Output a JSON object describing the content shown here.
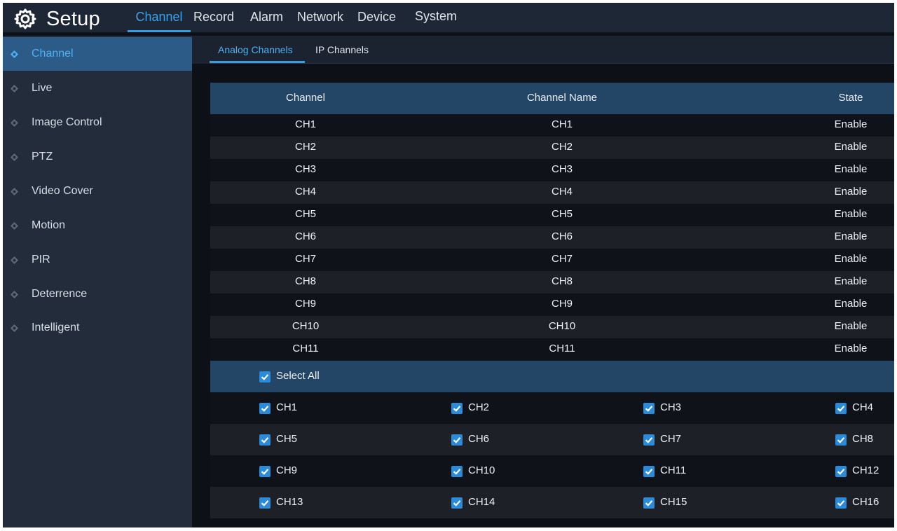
{
  "app": {
    "title": "Setup",
    "icon": "gear-icon"
  },
  "top_tabs": [
    "Channel",
    "Record",
    "Alarm",
    "Network",
    "Device",
    "System"
  ],
  "active_top_tab": "Channel",
  "sidebar": {
    "items": [
      {
        "label": "Channel",
        "active": true
      },
      {
        "label": "Live"
      },
      {
        "label": "Image Control"
      },
      {
        "label": "PTZ"
      },
      {
        "label": "Video Cover"
      },
      {
        "label": "Motion"
      },
      {
        "label": "PIR"
      },
      {
        "label": "Deterrence"
      },
      {
        "label": "Intelligent"
      }
    ]
  },
  "sub_tabs": [
    {
      "label": "Analog Channels",
      "active": true
    },
    {
      "label": "IP Channels"
    }
  ],
  "table": {
    "headers": [
      "Channel",
      "Channel Name",
      "State"
    ],
    "rows": [
      [
        "CH1",
        "CH1",
        "Enable"
      ],
      [
        "CH2",
        "CH2",
        "Enable"
      ],
      [
        "CH3",
        "CH3",
        "Enable"
      ],
      [
        "CH4",
        "CH4",
        "Enable"
      ],
      [
        "CH5",
        "CH5",
        "Enable"
      ],
      [
        "CH6",
        "CH6",
        "Enable"
      ],
      [
        "CH7",
        "CH7",
        "Enable"
      ],
      [
        "CH8",
        "CH8",
        "Enable"
      ],
      [
        "CH9",
        "CH9",
        "Enable"
      ],
      [
        "CH10",
        "CH10",
        "Enable"
      ],
      [
        "CH11",
        "CH11",
        "Enable"
      ]
    ]
  },
  "select_all": {
    "label": "Select All",
    "checked": true
  },
  "channel_checkboxes": [
    {
      "label": "CH1",
      "checked": true
    },
    {
      "label": "CH2",
      "checked": true
    },
    {
      "label": "CH3",
      "checked": true
    },
    {
      "label": "CH4",
      "checked": true
    },
    {
      "label": "CH5",
      "checked": true
    },
    {
      "label": "CH6",
      "checked": true
    },
    {
      "label": "CH7",
      "checked": true
    },
    {
      "label": "CH8",
      "checked": true
    },
    {
      "label": "CH9",
      "checked": true
    },
    {
      "label": "CH10",
      "checked": true
    },
    {
      "label": "CH11",
      "checked": true
    },
    {
      "label": "CH12",
      "checked": true
    },
    {
      "label": "CH13",
      "checked": true
    },
    {
      "label": "CH14",
      "checked": true
    },
    {
      "label": "CH15",
      "checked": true
    },
    {
      "label": "CH16",
      "checked": true
    }
  ],
  "colors": {
    "accent": "#3a9de0",
    "header_blue": "#244666",
    "sidebar_bg": "#222c3b",
    "sidebar_active": "#2c5b87",
    "checkbox": "#2b8bd9"
  }
}
